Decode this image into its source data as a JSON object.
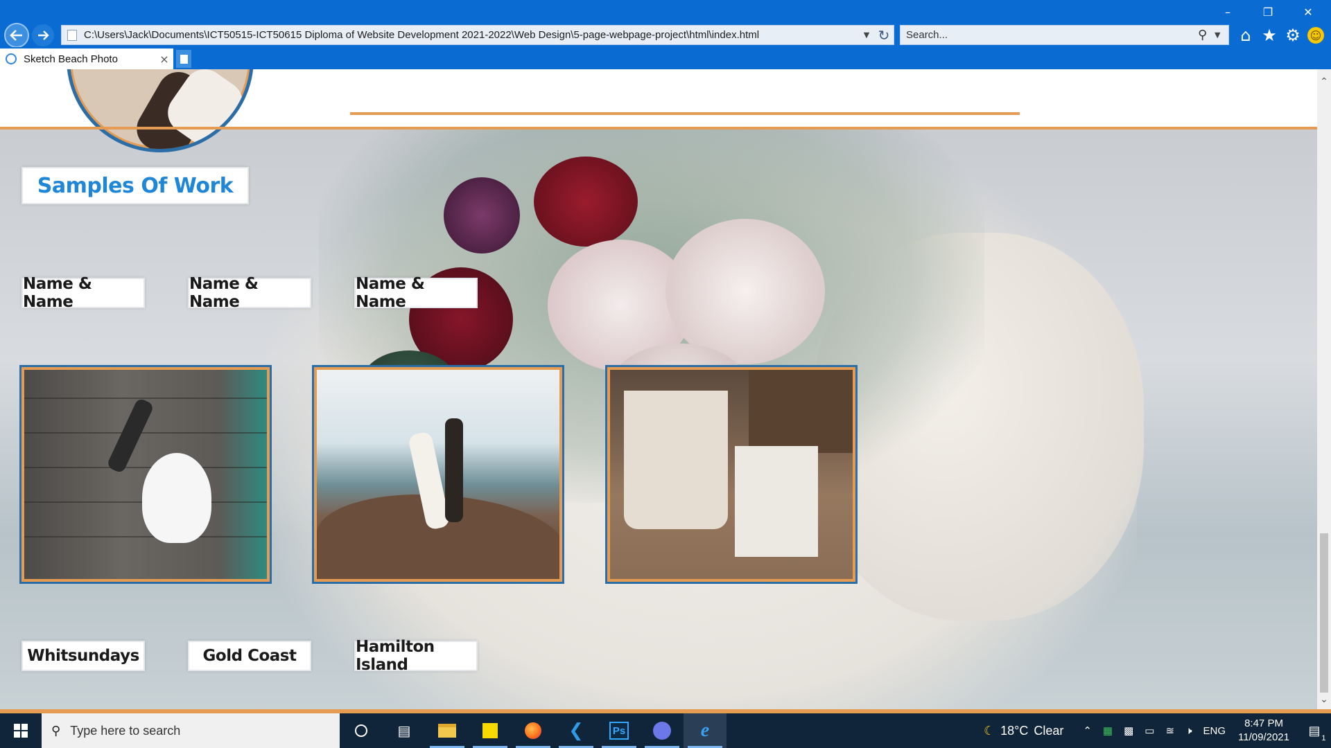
{
  "browser": {
    "address": "C:\\Users\\Jack\\Documents\\ICT50515-ICT50615 Diploma of Website Development 2021-2022\\Web Design\\5-page-webpage-project\\html\\index.html",
    "search_placeholder": "Search...",
    "tab_title": "Sketch Beach Photo",
    "tab_close": "×"
  },
  "page": {
    "section_title": "Samples Of Work",
    "name_labels": [
      "Name & Name",
      "Name & Name",
      "Name & Name"
    ],
    "location_labels": [
      "Whitsundays",
      "Gold Coast",
      "Hamilton Island"
    ],
    "accent_color": "#e59b52",
    "title_color": "#1f86d8",
    "frame_color": "#2b6da7"
  },
  "taskbar": {
    "search_placeholder": "Type here to search",
    "weather_temp": "18°C",
    "weather_text": "Clear",
    "language": "ENG",
    "time": "8:47 PM",
    "date": "11/09/2021",
    "notification_count": "1",
    "ps_label": "Ps"
  }
}
